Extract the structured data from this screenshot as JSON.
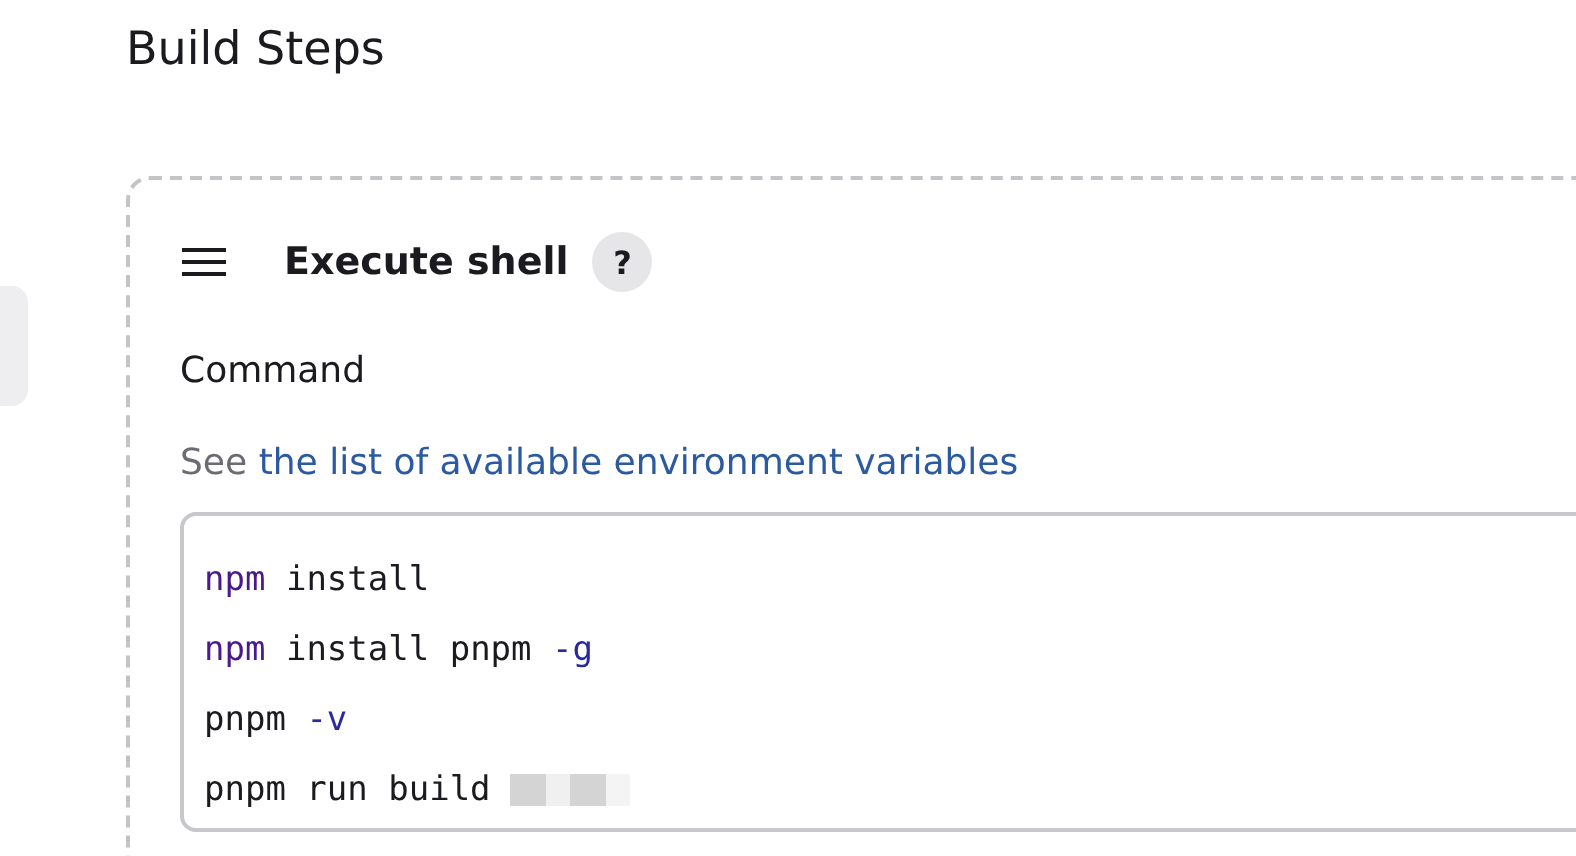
{
  "section_title": "Build Steps",
  "step": {
    "title": "Execute shell",
    "help": "?",
    "field_label": "Command",
    "hint_prefix": "See",
    "hint_link": "the list of available environment variables",
    "command_lines": [
      [
        {
          "kind": "keyword",
          "text": "npm"
        },
        {
          "kind": "plain",
          "text": " install"
        }
      ],
      [
        {
          "kind": "keyword",
          "text": "npm"
        },
        {
          "kind": "plain",
          "text": " install pnpm "
        },
        {
          "kind": "flag",
          "text": "-g"
        }
      ],
      [
        {
          "kind": "plain",
          "text": "pnpm "
        },
        {
          "kind": "flag",
          "text": "-v"
        }
      ],
      [
        {
          "kind": "plain",
          "text": "pnpm run build"
        }
      ]
    ]
  }
}
